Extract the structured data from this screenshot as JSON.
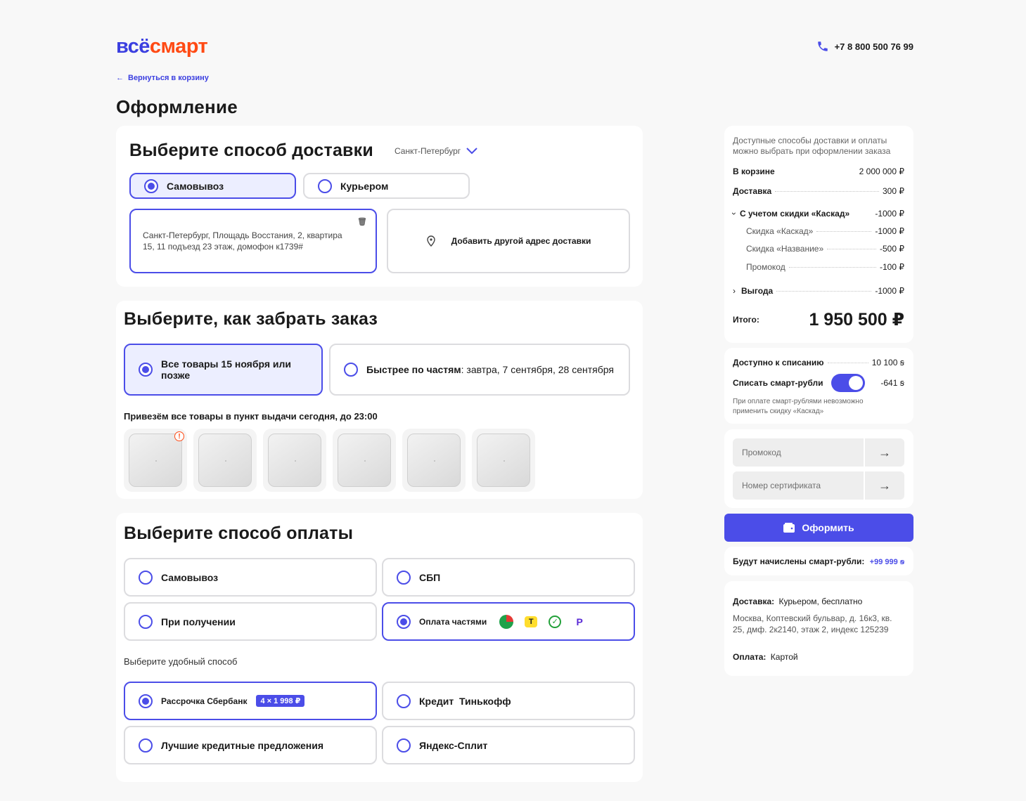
{
  "header": {
    "logo_part1": "всё",
    "logo_part2": "смарт",
    "phone": "+7 8 800 500 76 99",
    "back_link": "Вернуться в корзину",
    "page_title": "Оформление"
  },
  "delivery": {
    "title": "Выберите способ доставки",
    "city": "Санкт-Петербург",
    "options": [
      {
        "label": "Самовывоз",
        "selected": true
      },
      {
        "label": "Курьером",
        "selected": false
      }
    ],
    "address": "Санкт-Петербург, Площадь Восстания, 2, квартира 15, 11 подъезд 23 этаж, домофон к1739#",
    "add_address": "Добавить другой адрес доставки"
  },
  "pickup": {
    "title": "Выберите, как забрать заказ",
    "option_all": "Все товары 15 ноября или позже",
    "option_parts_bold": "Быстрее по частям",
    "option_parts_rest": ": завтра, 7 сентября, 28 сентября",
    "notice": "Привезём все товары в пункт выдачи сегодня, до 23:00",
    "warning_mark": "!"
  },
  "payment": {
    "title": "Выберите способ оплаты",
    "methods": [
      {
        "label": "Самовывоз",
        "selected": false
      },
      {
        "label": "СБП",
        "selected": false
      },
      {
        "label": "При получении",
        "selected": false
      },
      {
        "label": "Оплата частями",
        "selected": true
      }
    ],
    "installment_icons": [
      {
        "name": "split-icon",
        "glyph": "",
        "color": "#1fa24a"
      },
      {
        "name": "tinkoff-icon",
        "glyph": "T",
        "color": "#ffdd2d"
      },
      {
        "name": "sber-icon",
        "glyph": "✓",
        "color": "#21a038"
      },
      {
        "name": "yandex-pay-icon",
        "glyph": "P",
        "color": "#5a2bd6"
      }
    ],
    "choose_label": "Выберите удобный способ",
    "ways": [
      {
        "label": "Рассрочка Сбербанк",
        "badge": "4 × 1 998 ₽",
        "selected": true
      },
      {
        "label": "Кредит  Тинькофф",
        "selected": false
      },
      {
        "label": "Лучшие кредитные предложения",
        "selected": false
      },
      {
        "label": "Яндекс-Сплит",
        "selected": false
      }
    ]
  },
  "summary": {
    "note": "Доступные способы доставки и оплаты можно выбрать при оформлении заказа",
    "in_cart_label": "В корзине",
    "in_cart_value": "2 000 000 ₽",
    "delivery_label": "Доставка",
    "delivery_value": "300 ₽",
    "discount_group_label": "С учетом скидки «Каскад»",
    "discount_group_value": "-1000 ₽",
    "discounts": [
      {
        "label": "Скидка «Каскад»",
        "value": "-1000 ₽"
      },
      {
        "label": "Скидка «Название»",
        "value": "-500 ₽"
      },
      {
        "label": "Промокод",
        "value": "-100 ₽"
      }
    ],
    "benefit_label": "Выгода",
    "benefit_value": "-1000 ₽",
    "total_label": "Итого:",
    "total_value": "1 950 500 ₽"
  },
  "smart": {
    "available_label": "Доступно к списанию",
    "available_value": "10 100 ꞩ",
    "writeoff_label": "Списать смарт-рубли",
    "writeoff_value": "-641 ꞩ",
    "writeoff_enabled": true,
    "note": "При оплате смарт-рублями невозможно применить скидку «Каскад»"
  },
  "codes": {
    "promo_placeholder": "Промокод",
    "cert_placeholder": "Номер сертификата"
  },
  "checkout_button": "Оформить",
  "bonus": {
    "label": "Будут начислены смарт-рубли:",
    "value": "+99 999 ꞩ"
  },
  "order_info": {
    "delivery_label": "Доставка:",
    "delivery_value": "Курьером, бесплатно",
    "address": "Москва, Коптевский бульвар, д. 16к3, кв. 25, дмф. 2к2140, этаж 2, индекс 125239",
    "payment_label": "Оплата:",
    "payment_value": "Картой"
  },
  "colors": {
    "accent": "#4b4de8",
    "brand_blue": "#3b3fe0",
    "brand_orange": "#ff4a14",
    "selected_bg": "#eceeff"
  }
}
